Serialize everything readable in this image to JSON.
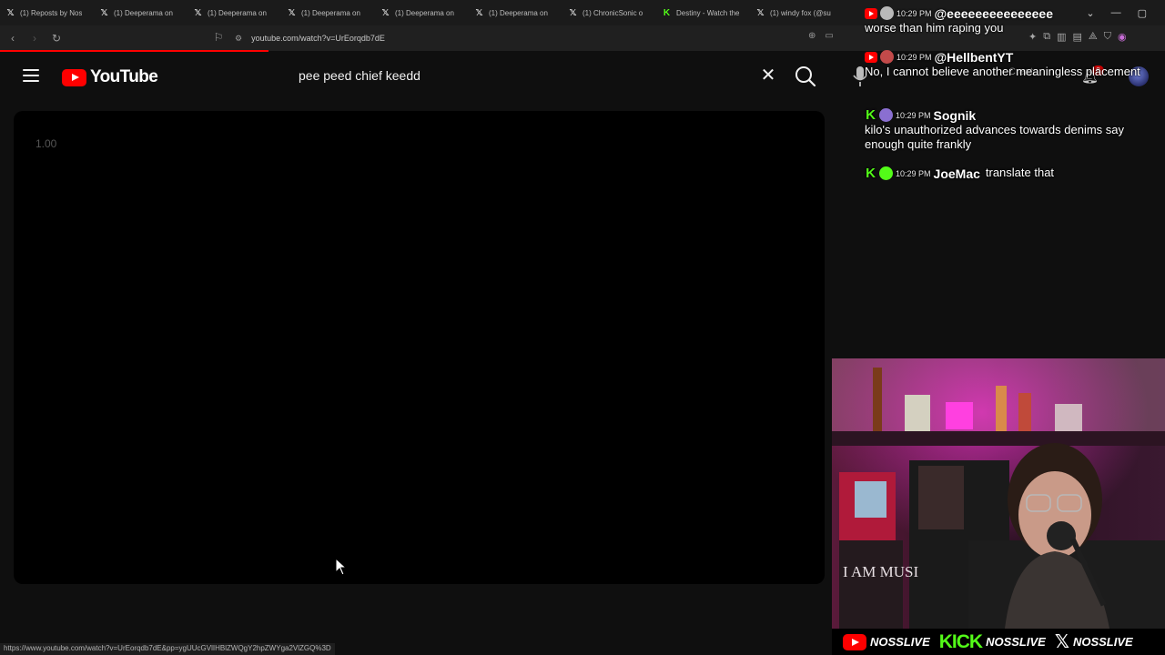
{
  "browser": {
    "tabs": [
      {
        "icon": "x-logo-icon",
        "title": "(1) Reposts by Nos"
      },
      {
        "icon": "x-logo-icon",
        "title": "(1) Deeperama on"
      },
      {
        "icon": "x-logo-icon",
        "title": "(1) Deeperama on"
      },
      {
        "icon": "x-logo-icon",
        "title": "(1) Deeperama on"
      },
      {
        "icon": "x-logo-icon",
        "title": "(1) Deeperama on"
      },
      {
        "icon": "x-logo-icon",
        "title": "(1) Deeperama on"
      },
      {
        "icon": "x-logo-icon",
        "title": "(1) ChronicSonic o"
      },
      {
        "icon": "kick-logo-icon",
        "title": "Destiny - Watch the"
      },
      {
        "icon": "x-logo-icon",
        "title": "(1) windy fox (@su"
      }
    ],
    "url": "youtube.com/watch?v=UrEorqdb7dE",
    "status_url": "https://www.youtube.com/watch?v=UrEorqdb7dE&pp=ygUUcGVlIHBlZWQgY2hpZWYga2VlZGQ%3D"
  },
  "youtube": {
    "logo_text": "YouTube",
    "search_query": "pee peed chief keedd",
    "create_label": "Create",
    "notification_count": "8",
    "player_speed": "1.00"
  },
  "chat": {
    "messages": [
      {
        "platform": "youtube",
        "time": "10:29 PM",
        "username": "@eeeeeeeeeeeeeee",
        "text": "worse than him raping you",
        "avatar_color": "#b9b9b9"
      },
      {
        "platform": "youtube",
        "time": "10:29 PM",
        "username": "@HellbentYT",
        "text": "No, I cannot believe another meaningless placement",
        "avatar_color": "#c24a4a"
      },
      {
        "platform": "kick",
        "time": "10:29 PM",
        "username": "Sognik",
        "text": "kilo's unauthorized advances towards denims say enough quite frankly",
        "avatar_color": "#8a6fd1"
      },
      {
        "platform": "kick",
        "time": "10:29 PM",
        "username": "JoeMac",
        "text": "translate that",
        "avatar_color": "#53fc18"
      }
    ]
  },
  "stream_bar": {
    "youtube_handle": "NOSSLIVE",
    "kick_logo": "KICK",
    "kick_handle": "NOSSLIVE",
    "x_handle": "NOSSLIVE"
  },
  "webcam": {
    "poster_text": "I AM MUSI"
  },
  "colors": {
    "youtube_red": "#ff0000",
    "kick_green": "#53fc18",
    "background": "#0f0f0f"
  }
}
